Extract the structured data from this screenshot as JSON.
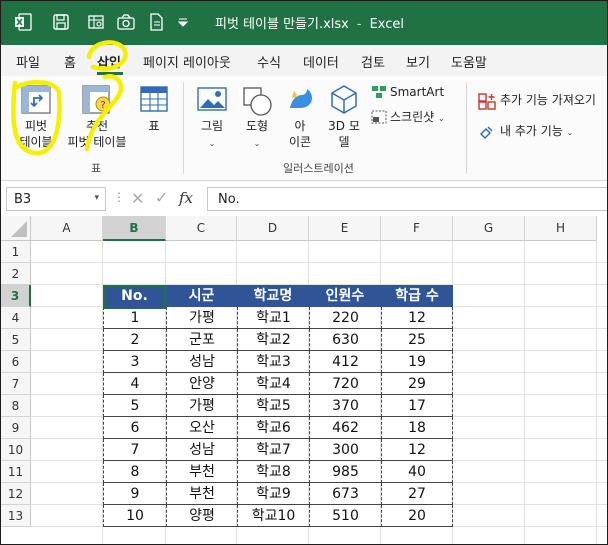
{
  "titlebar": {
    "filename": "피벗 테이블 만들기.xlsx",
    "separator": "-",
    "app": "Excel",
    "icons": [
      "excel-logo-icon",
      "save-icon",
      "sheet-view-icon",
      "camera-icon",
      "document-icon",
      "customize-toolbar-icon"
    ]
  },
  "menubar": {
    "tabs": [
      "파일",
      "홈",
      "삽입",
      "페이지 레이아웃",
      "수식",
      "데이터",
      "검토",
      "보기",
      "도움말"
    ],
    "active": "삽입"
  },
  "ribbon": {
    "pivot_table": {
      "line1": "피벗",
      "line2": "테이블"
    },
    "recommended_pivot": {
      "line1": "추천",
      "line2": "피벗 테이블"
    },
    "table": "표",
    "group_table": "표",
    "images": "그림",
    "shapes": "도형",
    "icons": {
      "line1": "아",
      "line2": "이콘"
    },
    "models_3d": {
      "line1": "3D 모",
      "line2": "델"
    },
    "smartart": "SmartArt",
    "screenshot": "스크린샷",
    "group_illustrations": "일러스트레이션",
    "get_addins": "추가 기능 가져오기",
    "my_addins": "내 추가 기능"
  },
  "formula_bar": {
    "name_box": "B3",
    "fx": "fx",
    "value": "No."
  },
  "sheet": {
    "columns": [
      "A",
      "B",
      "C",
      "D",
      "E",
      "F",
      "G",
      "H"
    ],
    "selected_column": "B",
    "rows": [
      "1",
      "2",
      "3",
      "4",
      "5",
      "6",
      "7",
      "8",
      "9",
      "10",
      "11",
      "12",
      "13"
    ],
    "selected_row": "3",
    "table_headers": [
      "No.",
      "시군",
      "학교명",
      "인원수",
      "학급 수"
    ],
    "table_rows": [
      [
        "1",
        "가평",
        "학교1",
        "220",
        "12"
      ],
      [
        "2",
        "군포",
        "학교2",
        "630",
        "25"
      ],
      [
        "3",
        "성남",
        "학교3",
        "412",
        "19"
      ],
      [
        "4",
        "안양",
        "학교4",
        "720",
        "29"
      ],
      [
        "5",
        "가평",
        "학교5",
        "370",
        "17"
      ],
      [
        "6",
        "오산",
        "학교6",
        "462",
        "18"
      ],
      [
        "7",
        "성남",
        "학교7",
        "300",
        "12"
      ],
      [
        "8",
        "부천",
        "학교8",
        "985",
        "40"
      ],
      [
        "9",
        "부천",
        "학교9",
        "673",
        "27"
      ],
      [
        "10",
        "양평",
        "학교10",
        "510",
        "20"
      ]
    ],
    "header_fill": "#2f5597"
  },
  "colors": {
    "excel_green": "#207245",
    "highlight": "#f5f000"
  }
}
